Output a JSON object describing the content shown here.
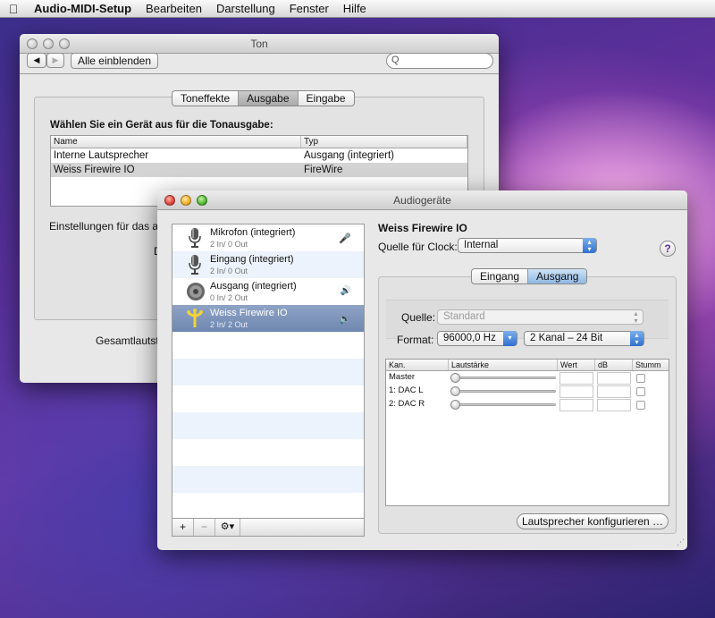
{
  "menubar": {
    "app": "Audio-MIDI-Setup",
    "items": [
      "Bearbeiten",
      "Darstellung",
      "Fenster",
      "Hilfe"
    ]
  },
  "ton_window": {
    "title": "Ton",
    "show_all": "Alle einblenden",
    "search_icon": "Q",
    "tabs": [
      "Toneffekte",
      "Ausgabe",
      "Eingabe"
    ],
    "selected_tab": "Ausgabe",
    "heading": "Wählen Sie ein Gerät aus für die Tonausgabe:",
    "columns": [
      "Name",
      "Typ"
    ],
    "rows": [
      {
        "name": "Interne Lautsprecher",
        "type": "Ausgang (integriert)"
      },
      {
        "name": "Weiss Firewire IO",
        "type": "FireWire"
      }
    ],
    "settings_label": "Einstellungen für das au",
    "d_label": "D",
    "volume_label": "Gesamtlautst"
  },
  "audio_window": {
    "title": "Audiogeräte",
    "devices": [
      {
        "name": "Mikrofon (integriert)",
        "io": "2 In/ 0 Out",
        "icon": "microphone-icon",
        "right_icon": "🎤"
      },
      {
        "name": "Eingang (integriert)",
        "io": "2 In/ 0 Out",
        "icon": "microphone-icon",
        "right_icon": ""
      },
      {
        "name": "Ausgang (integriert)",
        "io": "0 In/ 2 Out",
        "icon": "speaker-icon",
        "right_icon": "🔊"
      },
      {
        "name": "Weiss Firewire IO",
        "io": "2 In/ 2 Out",
        "icon": "firewire-icon",
        "right_icon": "🔈"
      }
    ],
    "footer": {
      "add": "+",
      "remove": "−",
      "gear": "⚙▾"
    },
    "device_title": "Weiss Firewire IO",
    "clock_label": "Quelle für Clock:",
    "clock_value": "Internal",
    "help": "?",
    "tabs": [
      "Eingang",
      "Ausgang"
    ],
    "selected_tab": "Ausgang",
    "source_label": "Quelle:",
    "source_value": "Standard",
    "format_label": "Format:",
    "format_rate": "96000,0 Hz",
    "format_channels": "2 Kanal – 24 Bit",
    "channel_table": {
      "columns": [
        "Kan.",
        "Lautstärke",
        "Wert",
        "dB",
        "Stumm"
      ],
      "rows": [
        {
          "name": "Master",
          "volume": 0,
          "muted": false
        },
        {
          "name": "1: DAC L",
          "volume": 0,
          "muted": false
        },
        {
          "name": "2: DAC R",
          "volume": 0,
          "muted": false
        }
      ]
    },
    "configure_button": "Lautsprecher konfigurieren …"
  }
}
